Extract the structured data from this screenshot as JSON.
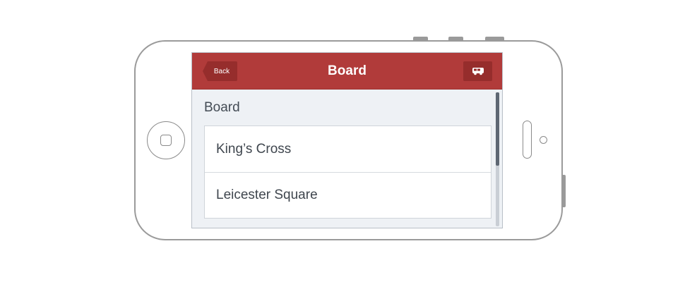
{
  "navbar": {
    "back_label": "Back",
    "title": "Board",
    "action_icon": "bus-icon"
  },
  "content": {
    "section_title": "Board",
    "items": [
      {
        "label": "King’s Cross"
      },
      {
        "label": "Leicester Square"
      }
    ]
  },
  "colors": {
    "navbar": "#b13b3a",
    "navbar_button": "#962d2c",
    "screen_background": "#eef1f5"
  }
}
